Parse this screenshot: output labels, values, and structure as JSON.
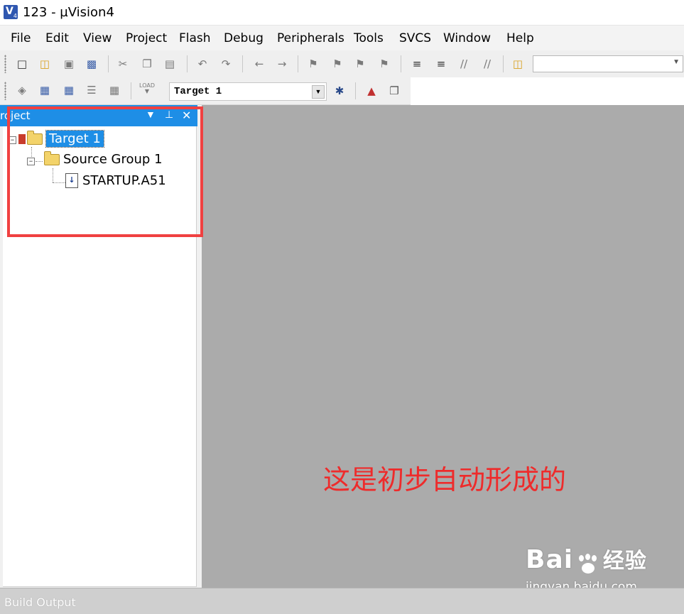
{
  "window": {
    "title": "123  - µVision4",
    "icon": "uvision-app-icon"
  },
  "menu": [
    "File",
    "Edit",
    "View",
    "Project",
    "Flash",
    "Debug",
    "Peripherals",
    "Tools",
    "SVCS",
    "Window",
    "Help"
  ],
  "toolbar": {
    "target_select": "Target 1",
    "file_icons": [
      "new-file-icon",
      "open-file-icon",
      "save-icon",
      "save-all-icon",
      "cut-icon",
      "copy-icon",
      "paste-icon",
      "undo-icon",
      "redo-icon",
      "back-icon",
      "forward-icon",
      "bookmark-icon",
      "prev-bookmark-icon",
      "next-bookmark-icon",
      "clear-bookmarks-icon",
      "indent-icon",
      "unindent-icon",
      "comment-icon",
      "uncomment-icon",
      "find-in-files-icon"
    ],
    "build_icons": [
      "translate-icon",
      "build-icon",
      "rebuild-icon",
      "batch-build-icon",
      "stop-build-icon",
      "download-icon",
      "target-options-icon",
      "manage-components-icon",
      "file-extensions-icon"
    ],
    "load_label": "LOAD"
  },
  "project_panel": {
    "title": "roject",
    "tree": {
      "target": "Target 1",
      "group": "Source Group 1",
      "file": "STARTUP.A51"
    }
  },
  "annotation": "这是初步自动形成的",
  "watermark": {
    "main": "Bai",
    "main2": "经验",
    "url": "jingyan.baidu.com"
  },
  "status": {
    "build_output": "Build Output"
  },
  "colors": {
    "highlight": "#f04040",
    "panel_header": "#1e8ee6",
    "workspace": "#ababab"
  }
}
